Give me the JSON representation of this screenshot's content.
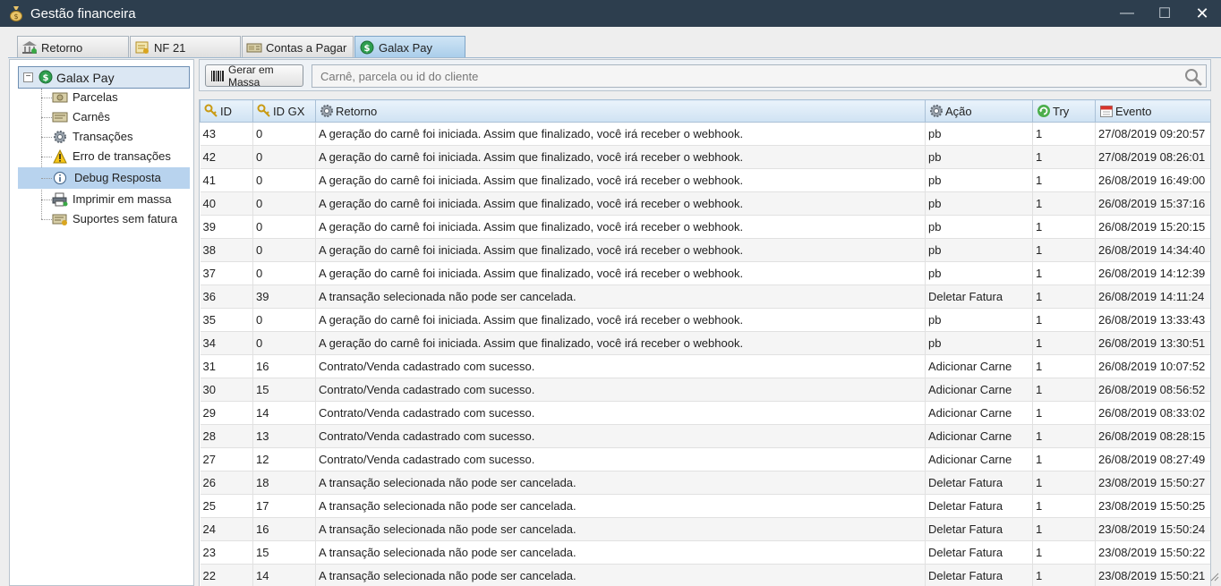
{
  "window": {
    "title": "Gestão financeira",
    "minimize": "—",
    "maximize": "☐",
    "close": "✕"
  },
  "tabs": [
    {
      "label": "Retorno",
      "icon": "bank-icon",
      "active": false
    },
    {
      "label": "NF 21",
      "icon": "invoice-icon",
      "active": false
    },
    {
      "label": "Contas a Pagar",
      "icon": "bill-icon",
      "active": false
    },
    {
      "label": "Galax Pay",
      "icon": "dollar-circle-icon",
      "active": true
    }
  ],
  "sidebar": {
    "root": {
      "label": "Galax Pay",
      "expander": "−"
    },
    "items": [
      {
        "label": "Parcelas",
        "icon": "money-icon"
      },
      {
        "label": "Carnês",
        "icon": "booklet-icon"
      },
      {
        "label": "Transações",
        "icon": "gear-icon"
      },
      {
        "label": "Erro de transações",
        "icon": "warning-icon"
      },
      {
        "label": "Debug Resposta",
        "icon": "info-icon",
        "selected": true
      },
      {
        "label": "Imprimir em massa",
        "icon": "printer-icon"
      },
      {
        "label": "Suportes sem fatura",
        "icon": "support-icon"
      }
    ]
  },
  "toolbar": {
    "mass_button_label": "Gerar em Massa",
    "search_placeholder": "Carnê, parcela ou id do cliente",
    "search_value": ""
  },
  "table": {
    "columns": [
      "ID",
      "ID GX",
      "Retorno",
      "Ação",
      "Try",
      "Evento"
    ],
    "rows": [
      [
        "43",
        "0",
        "A geração do carnê foi iniciada. Assim que finalizado, você irá receber o webhook.",
        "pb",
        "1",
        "27/08/2019 09:20:57"
      ],
      [
        "42",
        "0",
        "A geração do carnê foi iniciada. Assim que finalizado, você irá receber o webhook.",
        "pb",
        "1",
        "27/08/2019 08:26:01"
      ],
      [
        "41",
        "0",
        "A geração do carnê foi iniciada. Assim que finalizado, você irá receber o webhook.",
        "pb",
        "1",
        "26/08/2019 16:49:00"
      ],
      [
        "40",
        "0",
        "A geração do carnê foi iniciada. Assim que finalizado, você irá receber o webhook.",
        "pb",
        "1",
        "26/08/2019 15:37:16"
      ],
      [
        "39",
        "0",
        "A geração do carnê foi iniciada. Assim que finalizado, você irá receber o webhook.",
        "pb",
        "1",
        "26/08/2019 15:20:15"
      ],
      [
        "38",
        "0",
        "A geração do carnê foi iniciada. Assim que finalizado, você irá receber o webhook.",
        "pb",
        "1",
        "26/08/2019 14:34:40"
      ],
      [
        "37",
        "0",
        "A geração do carnê foi iniciada. Assim que finalizado, você irá receber o webhook.",
        "pb",
        "1",
        "26/08/2019 14:12:39"
      ],
      [
        "36",
        "39",
        "A transação selecionada não pode ser cancelada.",
        "Deletar Fatura",
        "1",
        "26/08/2019 14:11:24"
      ],
      [
        "35",
        "0",
        "A geração do carnê foi iniciada. Assim que finalizado, você irá receber o webhook.",
        "pb",
        "1",
        "26/08/2019 13:33:43"
      ],
      [
        "34",
        "0",
        "A geração do carnê foi iniciada. Assim que finalizado, você irá receber o webhook.",
        "pb",
        "1",
        "26/08/2019 13:30:51"
      ],
      [
        "31",
        "16",
        "Contrato/Venda cadastrado com sucesso.",
        "Adicionar Carne",
        "1",
        "26/08/2019 10:07:52"
      ],
      [
        "30",
        "15",
        "Contrato/Venda cadastrado com sucesso.",
        "Adicionar Carne",
        "1",
        "26/08/2019 08:56:52"
      ],
      [
        "29",
        "14",
        "Contrato/Venda cadastrado com sucesso.",
        "Adicionar Carne",
        "1",
        "26/08/2019 08:33:02"
      ],
      [
        "28",
        "13",
        "Contrato/Venda cadastrado com sucesso.",
        "Adicionar Carne",
        "1",
        "26/08/2019 08:28:15"
      ],
      [
        "27",
        "12",
        "Contrato/Venda cadastrado com sucesso.",
        "Adicionar Carne",
        "1",
        "26/08/2019 08:27:49"
      ],
      [
        "26",
        "18",
        "A transação selecionada não pode ser cancelada.",
        "Deletar Fatura",
        "1",
        "23/08/2019 15:50:27"
      ],
      [
        "25",
        "17",
        "A transação selecionada não pode ser cancelada.",
        "Deletar Fatura",
        "1",
        "23/08/2019 15:50:25"
      ],
      [
        "24",
        "16",
        "A transação selecionada não pode ser cancelada.",
        "Deletar Fatura",
        "1",
        "23/08/2019 15:50:24"
      ],
      [
        "23",
        "15",
        "A transação selecionada não pode ser cancelada.",
        "Deletar Fatura",
        "1",
        "23/08/2019 15:50:22"
      ],
      [
        "22",
        "14",
        "A transação selecionada não pode ser cancelada.",
        "Deletar Fatura",
        "1",
        "23/08/2019 15:50:21"
      ]
    ]
  },
  "colors": {
    "titlebar": "#2d3e4e",
    "accent": "#b8d3ee",
    "header_bg": "#cfe2f3"
  }
}
